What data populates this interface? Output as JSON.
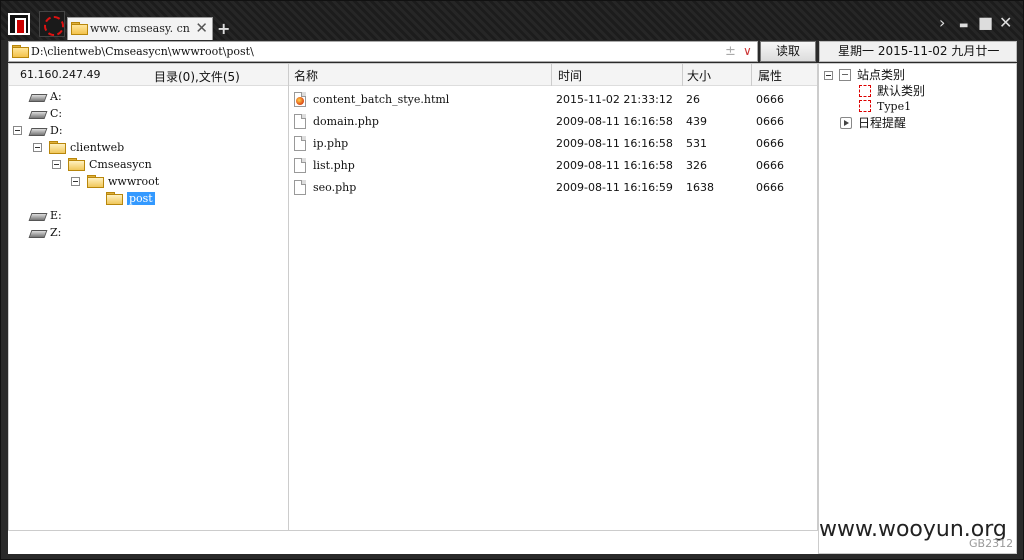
{
  "window": {
    "tab_label": "www. cmseasy. cn",
    "new_tab": "+",
    "close_tab": "✕",
    "controls": {
      "forward": "›",
      "minimize": "▬",
      "maximize": "■",
      "close": "✕"
    }
  },
  "toolbar": {
    "path": "D:\\clientweb\\Cmseasycn\\wwwroot\\post\\",
    "plusminus": "±",
    "dropdown": "∨",
    "read_button": "读取",
    "date_text": "星期一  2015-11-02  九月廿一"
  },
  "left": {
    "ip": "61.160.247.49",
    "counts": "目录(0),文件(5)",
    "tree": [
      {
        "label": "A:",
        "type": "drive"
      },
      {
        "label": "C:",
        "type": "drive"
      },
      {
        "label": "D:",
        "type": "drive",
        "expanded": true
      },
      {
        "label": "clientweb",
        "type": "folder",
        "expanded": true
      },
      {
        "label": "Cmseasycn",
        "type": "folder",
        "expanded": true
      },
      {
        "label": "wwwroot",
        "type": "folder",
        "expanded": true
      },
      {
        "label": "post",
        "type": "folder",
        "selected": true
      },
      {
        "label": "E:",
        "type": "drive"
      },
      {
        "label": "Z:",
        "type": "drive"
      }
    ]
  },
  "files": {
    "columns": {
      "name": "名称",
      "time": "时间",
      "size": "大小",
      "attr": "属性"
    },
    "rows": [
      {
        "name": "content_batch_stye.html",
        "time": "2015-11-02 21:33:12",
        "size": "26",
        "attr": "0666",
        "icon": "html-file-icon"
      },
      {
        "name": "domain.php",
        "time": "2009-08-11 16:16:58",
        "size": "439",
        "attr": "0666",
        "icon": "file-icon"
      },
      {
        "name": "ip.php",
        "time": "2009-08-11 16:16:58",
        "size": "531",
        "attr": "0666",
        "icon": "file-icon"
      },
      {
        "name": "list.php",
        "time": "2009-08-11 16:16:58",
        "size": "326",
        "attr": "0666",
        "icon": "file-icon"
      },
      {
        "name": "seo.php",
        "time": "2009-08-11 16:16:59",
        "size": "1638",
        "attr": "0666",
        "icon": "file-icon"
      }
    ]
  },
  "right": {
    "root": "站点类别",
    "items": [
      "默认类别",
      "Type1"
    ],
    "schedule": "日程提醒"
  },
  "footer": {
    "watermark": "www.wooyun.org",
    "encoding": "GB2312"
  }
}
